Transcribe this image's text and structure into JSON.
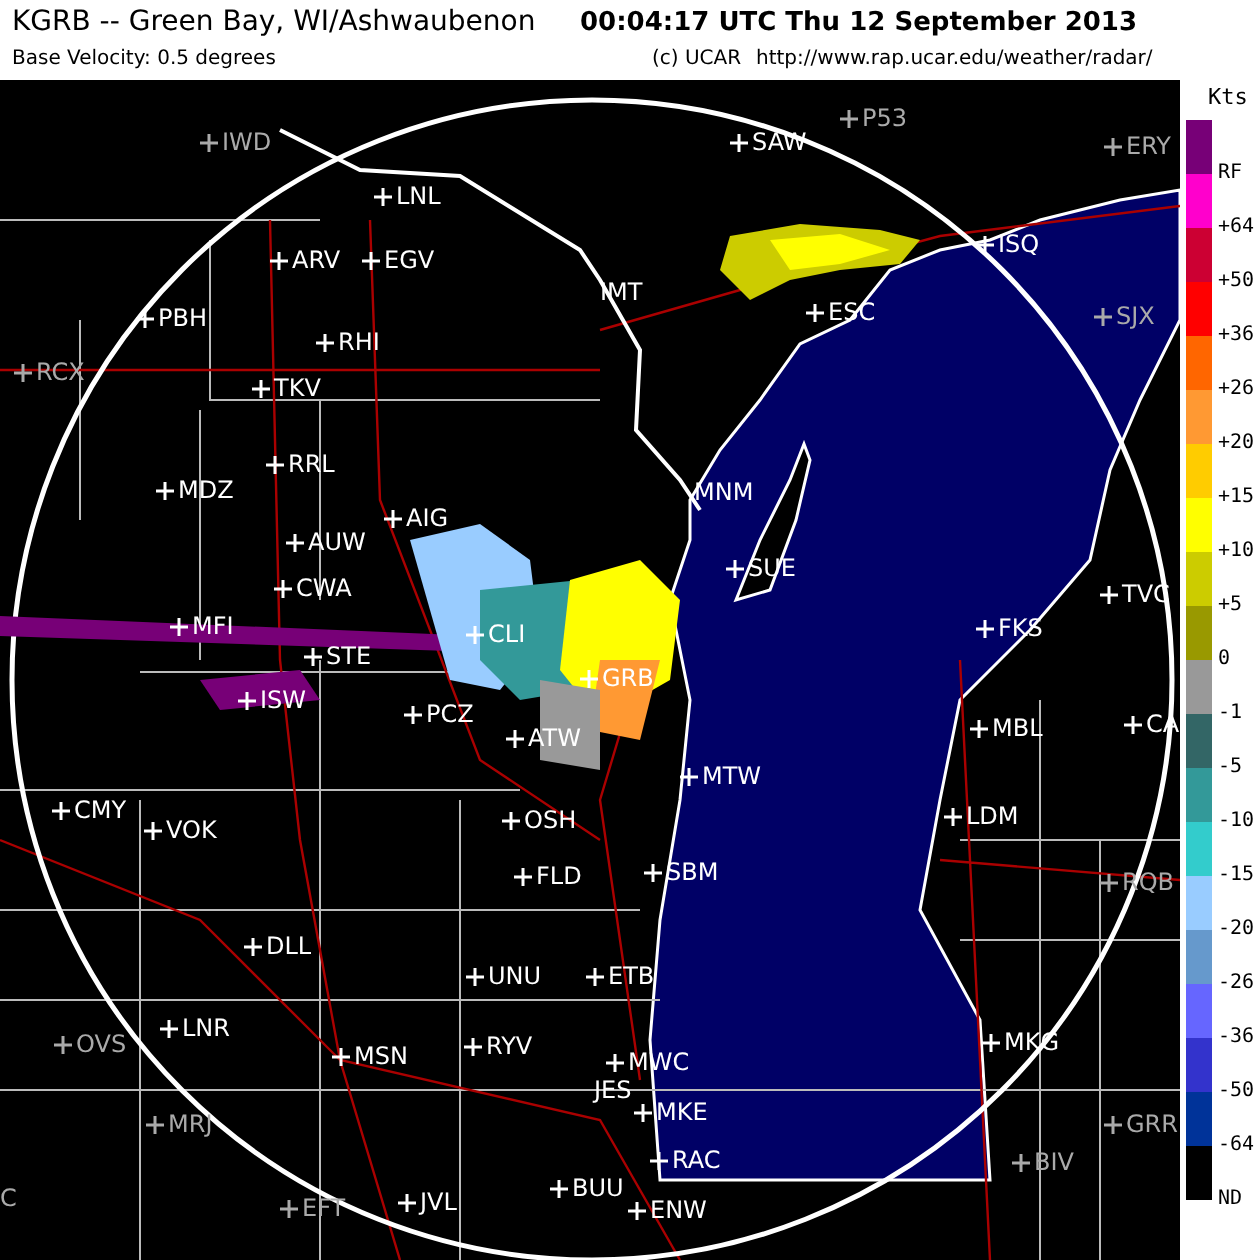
{
  "header": {
    "title": "KGRB -- Green Bay, WI/Ashwaubenon",
    "timestamp": "00:04:17 UTC Thu 12 September 2013",
    "product": "Base Velocity: 0.5 degrees",
    "credit": "(c) UCAR",
    "url": "http://www.rap.ucar.edu/weather/radar/"
  },
  "map": {
    "stations": [
      {
        "label": "IWD",
        "dim": true,
        "marker": true
      },
      {
        "label": "LNL",
        "dim": false,
        "marker": true
      },
      {
        "label": "ARV",
        "dim": false,
        "marker": true
      },
      {
        "label": "EGV",
        "dim": false,
        "marker": true
      },
      {
        "label": "PBH",
        "dim": false,
        "marker": true
      },
      {
        "label": "RHI",
        "dim": false,
        "marker": true
      },
      {
        "label": "RCX",
        "dim": true,
        "marker": true
      },
      {
        "label": "TKV",
        "dim": false,
        "marker": true
      },
      {
        "label": "RRL",
        "dim": false,
        "marker": true
      },
      {
        "label": "MDZ",
        "dim": false,
        "marker": true
      },
      {
        "label": "AIG",
        "dim": false,
        "marker": true
      },
      {
        "label": "AUW",
        "dim": false,
        "marker": true
      },
      {
        "label": "CWA",
        "dim": false,
        "marker": true
      },
      {
        "label": "MFI",
        "dim": false,
        "marker": true
      },
      {
        "label": "STE",
        "dim": false,
        "marker": true
      },
      {
        "label": "CLI",
        "dim": false,
        "marker": true
      },
      {
        "label": "GRB",
        "dim": false,
        "marker": true
      },
      {
        "label": "SAW",
        "dim": false,
        "marker": true
      },
      {
        "label": "P53",
        "dim": true,
        "marker": true
      },
      {
        "label": "ERY",
        "dim": true,
        "marker": true
      },
      {
        "label": "ISQ",
        "dim": false,
        "marker": true
      },
      {
        "label": "IMT",
        "dim": false,
        "marker": false
      },
      {
        "label": "ESC",
        "dim": false,
        "marker": true
      },
      {
        "label": "SJX",
        "dim": true,
        "marker": true
      },
      {
        "label": "MNM",
        "dim": false,
        "marker": false
      },
      {
        "label": "SUE",
        "dim": false,
        "marker": true
      },
      {
        "label": "TVC",
        "dim": false,
        "marker": true
      },
      {
        "label": "FKS",
        "dim": false,
        "marker": true
      },
      {
        "label": "ISW",
        "dim": false,
        "marker": true
      },
      {
        "label": "PCZ",
        "dim": false,
        "marker": true
      },
      {
        "label": "ATW",
        "dim": false,
        "marker": true
      },
      {
        "label": "CMY",
        "dim": false,
        "marker": true
      },
      {
        "label": "VOK",
        "dim": false,
        "marker": true
      },
      {
        "label": "OSH",
        "dim": false,
        "marker": true
      },
      {
        "label": "FLD",
        "dim": false,
        "marker": true
      },
      {
        "label": "MBL",
        "dim": false,
        "marker": true
      },
      {
        "label": "CA",
        "dim": false,
        "marker": true
      },
      {
        "label": "MTW",
        "dim": false,
        "marker": true
      },
      {
        "label": "LDM",
        "dim": false,
        "marker": true
      },
      {
        "label": "SBM",
        "dim": false,
        "marker": true
      },
      {
        "label": "RQB",
        "dim": true,
        "marker": true
      },
      {
        "label": "DLL",
        "dim": false,
        "marker": true
      },
      {
        "label": "UNU",
        "dim": false,
        "marker": true
      },
      {
        "label": "ETB",
        "dim": false,
        "marker": true
      },
      {
        "label": "LNR",
        "dim": false,
        "marker": true
      },
      {
        "label": "OVS",
        "dim": true,
        "marker": true
      },
      {
        "label": "MSN",
        "dim": false,
        "marker": true
      },
      {
        "label": "RYV",
        "dim": false,
        "marker": true
      },
      {
        "label": "MKG",
        "dim": false,
        "marker": true
      },
      {
        "label": "MWC",
        "dim": false,
        "marker": true
      },
      {
        "label": "JES",
        "dim": false,
        "marker": false
      },
      {
        "label": "MKE",
        "dim": false,
        "marker": true
      },
      {
        "label": "MRJ",
        "dim": true,
        "marker": true
      },
      {
        "label": "GRR",
        "dim": true,
        "marker": true
      },
      {
        "label": "RAC",
        "dim": false,
        "marker": true
      },
      {
        "label": "BIV",
        "dim": true,
        "marker": true
      },
      {
        "label": "C",
        "dim": true,
        "marker": false
      },
      {
        "label": "BUU",
        "dim": false,
        "marker": true
      },
      {
        "label": "EFT",
        "dim": true,
        "marker": true
      },
      {
        "label": "JVL",
        "dim": false,
        "marker": true
      },
      {
        "label": "ENW",
        "dim": false,
        "marker": true
      }
    ]
  },
  "legend": {
    "unit": "Kts",
    "bins": [
      {
        "label": "RF",
        "color": "#770077"
      },
      {
        "label": "+64",
        "color": "#ff00cc"
      },
      {
        "label": "+50",
        "color": "#cc0033"
      },
      {
        "label": "+36",
        "color": "#ff0000"
      },
      {
        "label": "+26",
        "color": "#ff6600"
      },
      {
        "label": "+20",
        "color": "#ff9933"
      },
      {
        "label": "+15",
        "color": "#ffcc00"
      },
      {
        "label": "+10",
        "color": "#ffff00"
      },
      {
        "label": "+5",
        "color": "#cccc00"
      },
      {
        "label": "0",
        "color": "#999900"
      },
      {
        "label": "-1",
        "color": "#999999"
      },
      {
        "label": "-5",
        "color": "#336666"
      },
      {
        "label": "-10",
        "color": "#339999"
      },
      {
        "label": "-15",
        "color": "#33cccc"
      },
      {
        "label": "-20",
        "color": "#99ccff"
      },
      {
        "label": "-26",
        "color": "#6699cc"
      },
      {
        "label": "-36",
        "color": "#6666ff"
      },
      {
        "label": "-50",
        "color": "#3333cc"
      },
      {
        "label": "-64",
        "color": "#003399"
      },
      {
        "label": "ND",
        "color": "#000000"
      }
    ]
  }
}
